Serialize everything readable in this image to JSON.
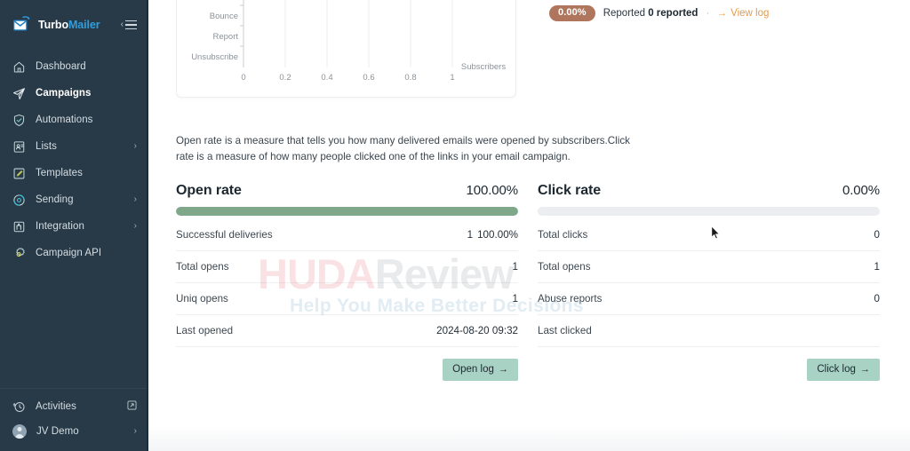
{
  "brand": {
    "name_part1": "Turbo",
    "name_part2": "Mailer",
    "logo_icon": "envelope-icon",
    "collapse_icon": "hamburger-collapse-icon"
  },
  "sidebar": {
    "items": [
      {
        "label": "Dashboard",
        "icon": "home-icon",
        "caret": "",
        "active": false
      },
      {
        "label": "Campaigns",
        "icon": "paper-plane-icon",
        "caret": "",
        "active": true
      },
      {
        "label": "Automations",
        "icon": "shield-check-icon",
        "caret": "",
        "active": false
      },
      {
        "label": "Lists",
        "icon": "list-users-icon",
        "caret": "›",
        "active": false
      },
      {
        "label": "Templates",
        "icon": "pencil-square-icon",
        "caret": "",
        "active": false
      },
      {
        "label": "Sending",
        "icon": "refresh-circle-icon",
        "caret": "›",
        "active": false
      },
      {
        "label": "Integration",
        "icon": "plug-icon",
        "caret": "›",
        "active": false
      },
      {
        "label": "Campaign API",
        "icon": "gear-icon",
        "caret": "",
        "active": false
      }
    ],
    "footer": {
      "activities_label": "Activities",
      "activities_icon": "clock-history-icon",
      "external_icon": "external-link-icon",
      "user_label": "JV Demo",
      "user_icon": "avatar-icon",
      "user_caret": "›"
    }
  },
  "report_status": {
    "percent_badge": "0.00%",
    "label_prefix": "Reported",
    "label_strong": "0 reported",
    "separator": "·",
    "view_log_label": "View log",
    "view_log_arrow": "→",
    "badge_color": "#b0755d",
    "link_color": "#e29b4b"
  },
  "description": "Open rate is a measure that tells you how many delivered emails were opened by subscribers.Click rate is a measure of how many people clicked one of the links in your email campaign.",
  "open_rate_panel": {
    "title": "Open rate",
    "value": "100.00%",
    "bar_percent": 100,
    "bar_color": "#7fa88b",
    "rows": [
      {
        "key": "Successful deliveries",
        "value": "1",
        "sub": "100.00%"
      },
      {
        "key": "Total opens",
        "value": "1",
        "sub": ""
      },
      {
        "key": "Uniq opens",
        "value": "1",
        "sub": ""
      },
      {
        "key": "Last opened",
        "value": "2024-08-20 09:32",
        "sub": ""
      }
    ],
    "button_label": "Open log",
    "button_arrow": "→",
    "button_color": "#a8d2c4"
  },
  "click_rate_panel": {
    "title": "Click rate",
    "value": "0.00%",
    "bar_percent": 0,
    "bar_color": "#7fa88b",
    "rows": [
      {
        "key": "Total clicks",
        "value": "0",
        "sub": ""
      },
      {
        "key": "Total opens",
        "value": "1",
        "sub": ""
      },
      {
        "key": "Abuse reports",
        "value": "0",
        "sub": ""
      },
      {
        "key": "Last clicked",
        "value": "",
        "sub": ""
      }
    ],
    "button_label": "Click log",
    "button_arrow": "→",
    "button_color": "#a8d2c4"
  },
  "chart_data": {
    "type": "bar",
    "orientation": "horizontal",
    "title": "",
    "xlabel": "Subscribers",
    "ylabel": "",
    "categories": [
      "Bounce",
      "Report",
      "Unsubscribe"
    ],
    "values": [
      0,
      0,
      0
    ],
    "xticks": [
      "0",
      "0.2",
      "0.4",
      "0.6",
      "0.8",
      "1"
    ],
    "xlim": [
      0,
      1
    ],
    "grid": true,
    "legend": false
  },
  "watermark": {
    "line1_part1": "HUDA",
    "line1_part2": "Review",
    "line2": "Help You Make Better Decisions"
  }
}
